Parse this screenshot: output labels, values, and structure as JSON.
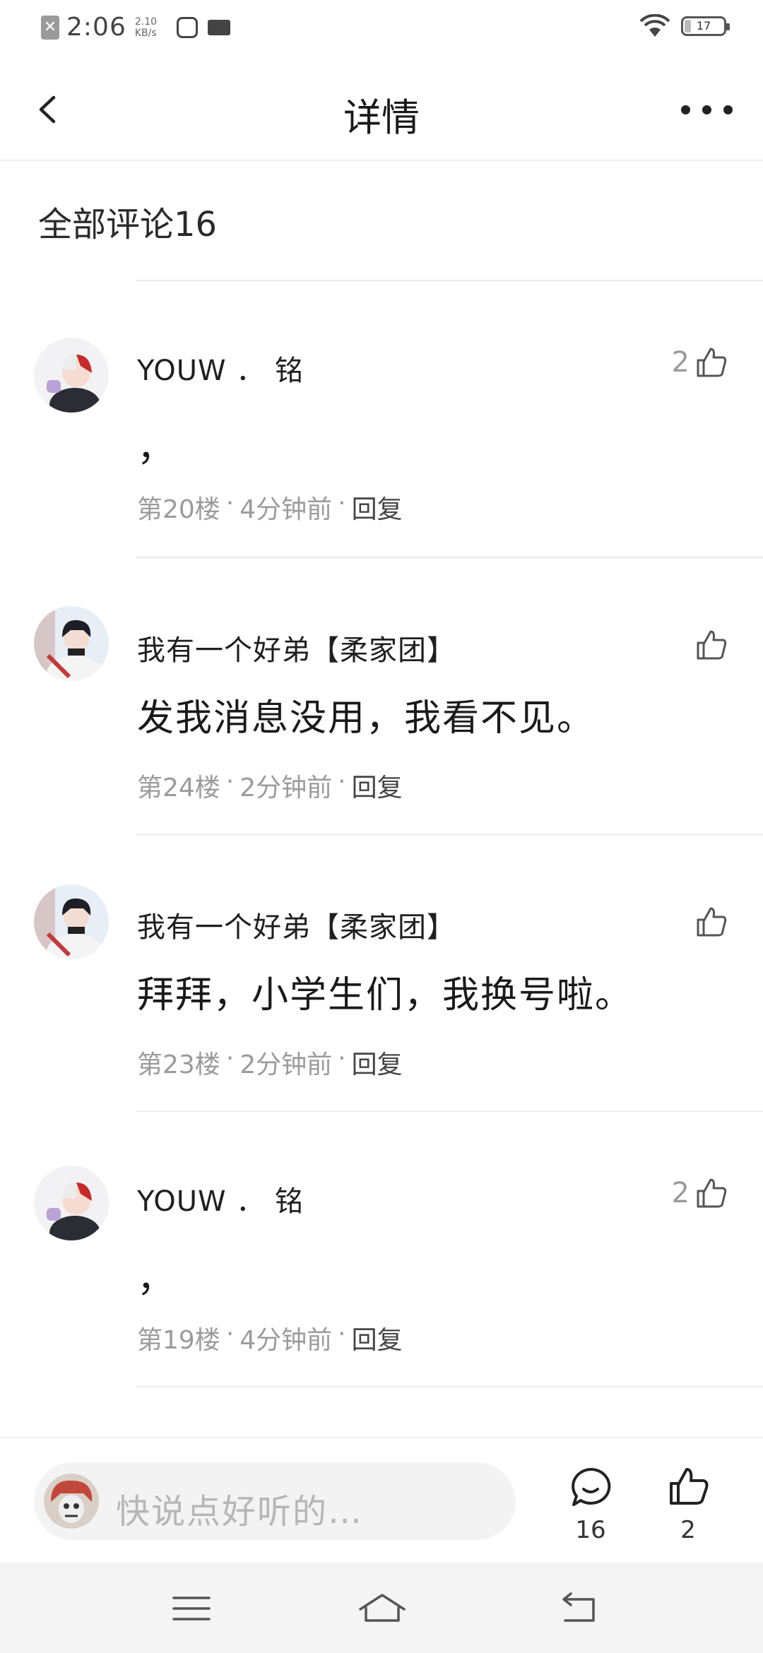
{
  "status_bar": {
    "time": "2:06",
    "net_speed_value": "2.10",
    "net_speed_unit": "KB/s",
    "battery": "17",
    "battery_level": 0.17
  },
  "nav": {
    "title": "详情"
  },
  "comments_header": "全部评论16",
  "comments": [
    {
      "author": "YOUW ． 铭",
      "text": "，",
      "floor": "第20楼",
      "time": "4分钟前",
      "reply": "回复",
      "likes": "2",
      "avatar": "avatar-red-white-hair"
    },
    {
      "author": "我有一个好弟【柔家团】",
      "text": "发我消息没用，我看不见。",
      "floor": "第24楼",
      "time": "2分钟前",
      "reply": "回复",
      "likes": "",
      "avatar": "avatar-black-hair"
    },
    {
      "author": "我有一个好弟【柔家团】",
      "text": "拜拜，小学生们，我换号啦。",
      "floor": "第23楼",
      "time": "2分钟前",
      "reply": "回复",
      "likes": "",
      "avatar": "avatar-black-hair"
    },
    {
      "author": "YOUW ． 铭",
      "text": "，",
      "floor": "第19楼",
      "time": "4分钟前",
      "reply": "回复",
      "likes": "2",
      "avatar": "avatar-red-white-hair"
    }
  ],
  "meta_separator": "·",
  "bottom_bar": {
    "placeholder": "快说点好听的…",
    "comment_count": "16",
    "like_count": "2"
  }
}
